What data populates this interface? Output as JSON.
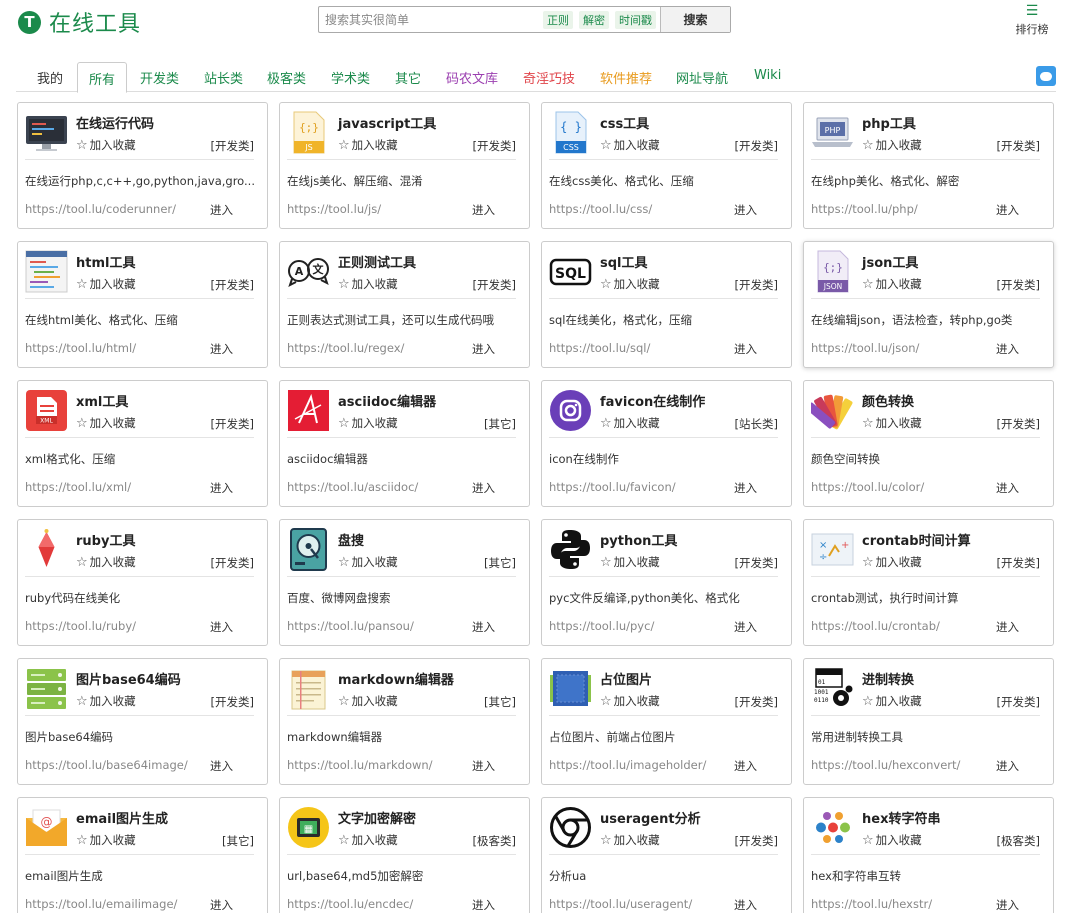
{
  "header": {
    "logo_glyph": "T",
    "logo_text": "在线工具",
    "search_placeholder": "搜索其实很简单",
    "quick_tags": [
      "正则",
      "解密",
      "时间戳"
    ],
    "search_button": "搜索",
    "rank_icon": "list-icon",
    "rank_label": "排行榜"
  },
  "nav": {
    "items": [
      "我的",
      "所有",
      "开发类",
      "站长类",
      "极客类",
      "学术类",
      "其它",
      "码农文库",
      "奇淫巧技",
      "软件推荐",
      "网址导航",
      "Wiki"
    ],
    "active_index": 1,
    "colors": [
      "#333333",
      "#1b8a4b",
      "#1b8a4b",
      "#1b8a4b",
      "#1b8a4b",
      "#1b8a4b",
      "#1b8a4b",
      "#9b3fb0",
      "#e0444a",
      "#e89a1c",
      "#1b8a4b",
      "#1b8a4b"
    ],
    "chat_icon": "chat-icon"
  },
  "tools": [
    {
      "title": "在线运行代码",
      "fav": "加入收藏",
      "category": "[开发类]",
      "desc": "在线运行php,c,c++,go,python,java,gro...",
      "url": "https://tool.lu/coderunner/",
      "enter": "进入",
      "icon": "monitor-icon"
    },
    {
      "title": "javascript工具",
      "fav": "加入收藏",
      "category": "[开发类]",
      "desc": "在线js美化、解压缩、混淆",
      "url": "https://tool.lu/js/",
      "enter": "进入",
      "icon": "js-file-icon"
    },
    {
      "title": "css工具",
      "fav": "加入收藏",
      "category": "[开发类]",
      "desc": "在线css美化、格式化、压缩",
      "url": "https://tool.lu/css/",
      "enter": "进入",
      "icon": "css-file-icon"
    },
    {
      "title": "php工具",
      "fav": "加入收藏",
      "category": "[开发类]",
      "desc": "在线php美化、格式化、解密",
      "url": "https://tool.lu/php/",
      "enter": "进入",
      "icon": "php-laptop-icon"
    },
    {
      "title": "html工具",
      "fav": "加入收藏",
      "category": "[开发类]",
      "desc": "在线html美化、格式化、压缩",
      "url": "https://tool.lu/html/",
      "enter": "进入",
      "icon": "html-code-icon"
    },
    {
      "title": "正则测试工具",
      "fav": "加入收藏",
      "category": "[开发类]",
      "desc": "正则表达式测试工具，还可以生成代码哦",
      "url": "https://tool.lu/regex/",
      "enter": "进入",
      "icon": "regex-bubbles-icon"
    },
    {
      "title": "sql工具",
      "fav": "加入收藏",
      "category": "[开发类]",
      "desc": "sql在线美化，格式化，压缩",
      "url": "https://tool.lu/sql/",
      "enter": "进入",
      "icon": "sql-icon"
    },
    {
      "title": "json工具",
      "fav": "加入收藏",
      "category": "[开发类]",
      "desc": "在线编辑json，语法检查，转php,go类",
      "url": "https://tool.lu/json/",
      "enter": "进入",
      "icon": "json-file-icon"
    },
    {
      "title": "xml工具",
      "fav": "加入收藏",
      "category": "[开发类]",
      "desc": "xml格式化、压缩",
      "url": "https://tool.lu/xml/",
      "enter": "进入",
      "icon": "xml-file-icon"
    },
    {
      "title": "asciidoc编辑器",
      "fav": "加入收藏",
      "category": "[其它]",
      "desc": "asciidoc编辑器",
      "url": "https://tool.lu/asciidoc/",
      "enter": "进入",
      "icon": "asciidoc-icon"
    },
    {
      "title": "favicon在线制作",
      "fav": "加入收藏",
      "category": "[站长类]",
      "desc": "icon在线制作",
      "url": "https://tool.lu/favicon/",
      "enter": "进入",
      "icon": "camera-icon"
    },
    {
      "title": "颜色转换",
      "fav": "加入收藏",
      "category": "[开发类]",
      "desc": "颜色空间转换",
      "url": "https://tool.lu/color/",
      "enter": "进入",
      "icon": "color-swatch-icon"
    },
    {
      "title": "ruby工具",
      "fav": "加入收藏",
      "category": "[开发类]",
      "desc": "ruby代码在线美化",
      "url": "https://tool.lu/ruby/",
      "enter": "进入",
      "icon": "ruby-gem-icon"
    },
    {
      "title": "盘搜",
      "fav": "加入收藏",
      "category": "[其它]",
      "desc": "百度、微博网盘搜索",
      "url": "https://tool.lu/pansou/",
      "enter": "进入",
      "icon": "hard-disk-icon"
    },
    {
      "title": "python工具",
      "fav": "加入收藏",
      "category": "[开发类]",
      "desc": "pyc文件反编译,python美化、格式化",
      "url": "https://tool.lu/pyc/",
      "enter": "进入",
      "icon": "python-icon"
    },
    {
      "title": "crontab时间计算",
      "fav": "加入收藏",
      "category": "[开发类]",
      "desc": "crontab测试，执行时间计算",
      "url": "https://tool.lu/crontab/",
      "enter": "进入",
      "icon": "crontab-icon"
    },
    {
      "title": "图片base64编码",
      "fav": "加入收藏",
      "category": "[开发类]",
      "desc": "图片base64编码",
      "url": "https://tool.lu/base64image/",
      "enter": "进入",
      "icon": "server-stack-icon"
    },
    {
      "title": "markdown编辑器",
      "fav": "加入收藏",
      "category": "[其它]",
      "desc": "markdown编辑器",
      "url": "https://tool.lu/markdown/",
      "enter": "进入",
      "icon": "notepad-icon"
    },
    {
      "title": "占位图片",
      "fav": "加入收藏",
      "category": "[开发类]",
      "desc": "占位图片、前端占位图片",
      "url": "https://tool.lu/imageholder/",
      "enter": "进入",
      "icon": "image-placeholder-icon"
    },
    {
      "title": "进制转换",
      "fav": "加入收藏",
      "category": "[开发类]",
      "desc": "常用进制转换工具",
      "url": "https://tool.lu/hexconvert/",
      "enter": "进入",
      "icon": "binary-gear-icon"
    },
    {
      "title": "email图片生成",
      "fav": "加入收藏",
      "category": "[其它]",
      "desc": "email图片生成",
      "url": "https://tool.lu/emailimage/",
      "enter": "进入",
      "icon": "email-icon"
    },
    {
      "title": "文字加密解密",
      "fav": "加入收藏",
      "category": "[极客类]",
      "desc": "url,base64,md5加密解密",
      "url": "https://tool.lu/encdec/",
      "enter": "进入",
      "icon": "calculator-icon"
    },
    {
      "title": "useragent分析",
      "fav": "加入收藏",
      "category": "[开发类]",
      "desc": "分析ua",
      "url": "https://tool.lu/useragent/",
      "enter": "进入",
      "icon": "chrome-icon"
    },
    {
      "title": "hex转字符串",
      "fav": "加入收藏",
      "category": "[极客类]",
      "desc": "hex和字符串互转",
      "url": "https://tool.lu/hexstr/",
      "enter": "进入",
      "icon": "dots-icon"
    }
  ]
}
